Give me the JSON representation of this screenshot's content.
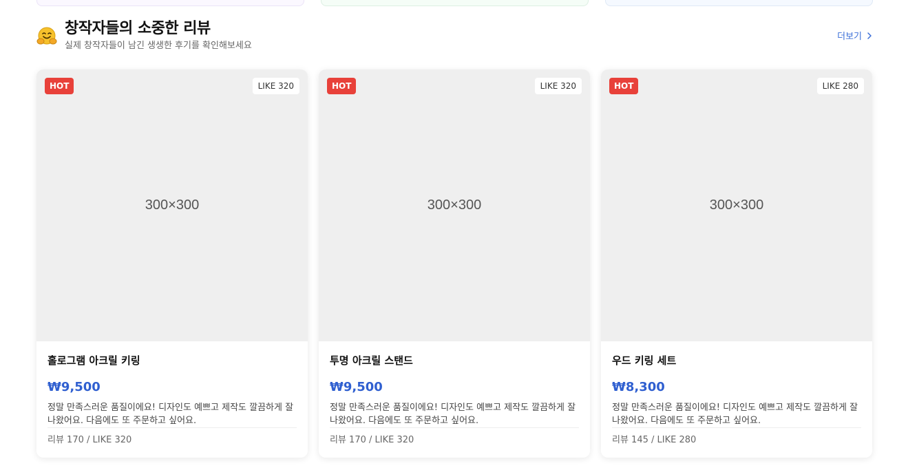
{
  "section": {
    "title": "창작자들의 소중한 리뷰",
    "subtitle": "실제 창작자들이 남긴 생생한 후기를 확인해보세요",
    "more_label": "더보기",
    "icon": "hugging-face-icon"
  },
  "colors": {
    "hot_badge": "#e8413a",
    "price": "#2f5fd0",
    "link": "#3b6fd8"
  },
  "cards": [
    {
      "badge": "HOT",
      "like_badge": "LIKE 320",
      "image_placeholder": "300×300",
      "name": "홀로그램 아크릴 키링",
      "price": "₩9,500",
      "review": "정말 만족스러운 품질이에요! 디자인도 예쁘고 제작도 깔끔하게 잘 나왔어요. 다음에도 또 주문하고 싶어요.",
      "meta": "리뷰 170 / LIKE 320"
    },
    {
      "badge": "HOT",
      "like_badge": "LIKE 320",
      "image_placeholder": "300×300",
      "name": "투명 아크릴 스탠드",
      "price": "₩9,500",
      "review": "정말 만족스러운 품질이에요! 디자인도 예쁘고 제작도 깔끔하게 잘 나왔어요. 다음에도 또 주문하고 싶어요.",
      "meta": "리뷰 170 / LIKE 320"
    },
    {
      "badge": "HOT",
      "like_badge": "LIKE 280",
      "image_placeholder": "300×300",
      "name": "우드 키링 세트",
      "price": "₩8,300",
      "review": "정말 만족스러운 품질이에요! 디자인도 예쁘고 제작도 깔끔하게 잘 나왔어요. 다음에도 또 주문하고 싶어요.",
      "meta": "리뷰 145 / LIKE 280"
    }
  ]
}
